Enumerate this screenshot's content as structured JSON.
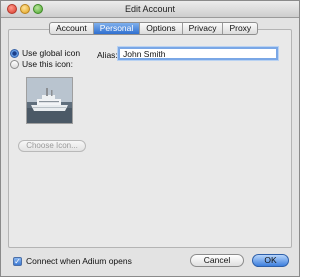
{
  "window": {
    "title": "Edit Account"
  },
  "tabs": [
    {
      "label": "Account",
      "selected": false
    },
    {
      "label": "Personal",
      "selected": true
    },
    {
      "label": "Options",
      "selected": false
    },
    {
      "label": "Privacy",
      "selected": false
    },
    {
      "label": "Proxy",
      "selected": false
    }
  ],
  "icon_choice": {
    "use_global_label": "Use global icon",
    "use_this_label": "Use this icon:",
    "selected": "use_global",
    "preview_icon": "ship-image",
    "choose_button_label": "Choose Icon..."
  },
  "alias": {
    "label": "Alias:",
    "value": "John Smith"
  },
  "footer": {
    "connect_label": "Connect when Adium opens",
    "connect_checked": true,
    "cancel_label": "Cancel",
    "ok_label": "OK"
  },
  "colors": {
    "accent": "#3d7fdd",
    "selected_tab": "#2f6fd0"
  }
}
